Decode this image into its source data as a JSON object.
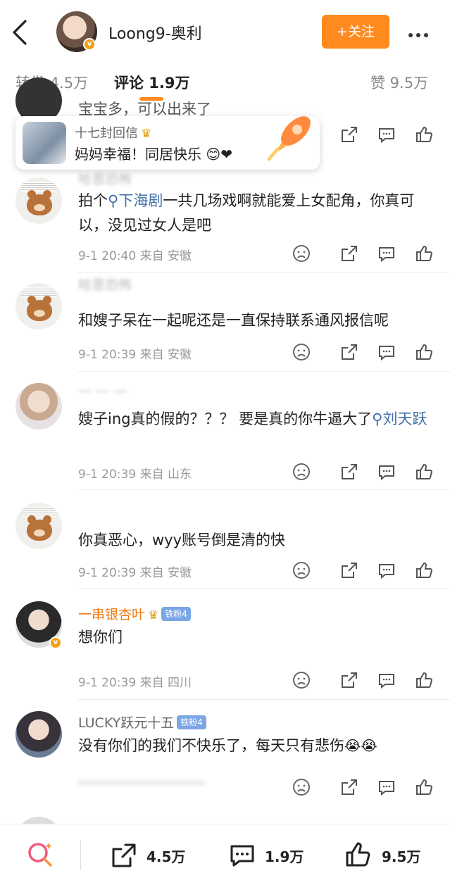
{
  "header": {
    "title": "Loong9-奥利",
    "follow_label": "+关注",
    "verified_mark": "v"
  },
  "tabs": {
    "repost": "转发 4.5万",
    "comments": "评论 1.9万",
    "likes": "赞 9.5万"
  },
  "popup": {
    "name": "十七封回信",
    "text": "妈妈幸福！同居快乐",
    "emoji": "😊❤",
    "icon": "rocket-icon"
  },
  "top_partial_text": "宝宝多，可以出来了",
  "comments": [
    {
      "name": "哈恩恐怖",
      "text_before": "拍个",
      "link": "下海剧",
      "text_after": "一共几场戏啊就能爱上女配角，你真可以，没见过女人是吧",
      "time": "9-1 20:40",
      "source": "来自 安徽"
    },
    {
      "name": "哈恩恐怖",
      "text": "和嫂子呆在一起呢还是一直保持联系通风报信呢",
      "time": "9-1 20:39",
      "source": "来自 安徽"
    },
    {
      "name": "— — —",
      "text_before": "嫂子ing真的假的？？？ 要是真的你牛逼大了",
      "link": "刘天跃",
      "time": "9-1 20:39",
      "source": "来自 山东"
    },
    {
      "name": "",
      "text": "你真恶心，wyy账号倒是清的快",
      "time": "9-1 20:39",
      "source": "来自 安徽"
    },
    {
      "name": "一串银杏叶",
      "badge": "铁粉4",
      "text": "想你们",
      "time": "9-1 20:39",
      "source": "来自 四川"
    },
    {
      "name": "LUCKY跃元十五",
      "badge": "铁粉4",
      "text": "没有你们的我们不快乐了，每天只有悲伤",
      "emoji": "😭😭",
      "time": "",
      "source": ""
    }
  ],
  "bottom": {
    "repost": "4.5万",
    "comment": "1.9万",
    "like": "9.5万"
  },
  "colors": {
    "accent": "#ff8a1e",
    "link": "#3f6fa7",
    "meta": "#999999"
  }
}
